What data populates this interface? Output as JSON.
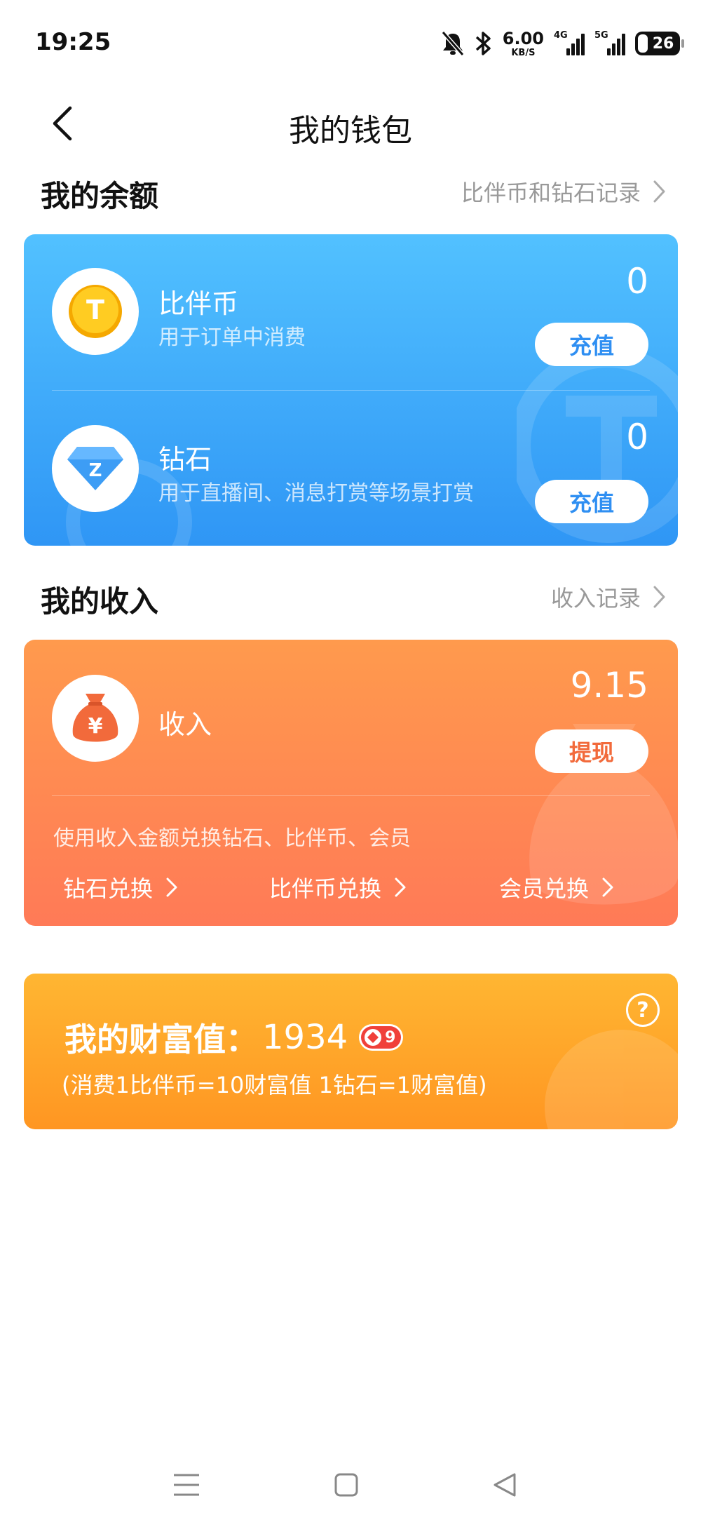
{
  "status_bar": {
    "time": "19:25",
    "net_speed_value": "6.00",
    "net_speed_unit": "KB/S",
    "sim1_tag": "4G",
    "sim2_tag": "5G",
    "battery": "26"
  },
  "nav": {
    "title": "我的钱包"
  },
  "balance_section": {
    "title": "我的余额",
    "link": "比伴币和钻石记录"
  },
  "balance_card": {
    "coin": {
      "title": "比伴币",
      "subtitle": "用于订单中消费",
      "value": "0",
      "button": "充值",
      "icon": "coin-icon",
      "icon_letter": "T"
    },
    "diamond": {
      "title": "钻石",
      "subtitle": "用于直播间、消息打赏等场景打赏",
      "value": "0",
      "button": "充值",
      "icon": "diamond-icon",
      "icon_letter": "Z"
    },
    "button_color": "#2f8ff2"
  },
  "income_section": {
    "title": "我的收入",
    "link": "收入记录"
  },
  "income_card": {
    "title": "收入",
    "value": "9.15",
    "button": "提现",
    "icon": "money-bag-icon",
    "icon_symbol": "¥",
    "hint": "使用收入金额兑换钻石、比伴币、会员",
    "exchange": [
      "钻石兑换",
      "比伴币兑换",
      "会员兑换"
    ],
    "button_color": "#f26a3b"
  },
  "wealth_card": {
    "label": "我的财富值：",
    "value": "1934",
    "level": "9",
    "note": "(消费1比伴币=10财富值 1钻石=1财富值)",
    "help": "?"
  },
  "colors": {
    "balance_gradient": [
      "#52c1ff",
      "#2f96f5"
    ],
    "income_gradient": [
      "#ff9a4d",
      "#ff7a57"
    ],
    "wealth_gradient": [
      "#ffb632",
      "#ff9622"
    ],
    "level_badge": "#f0403a"
  }
}
